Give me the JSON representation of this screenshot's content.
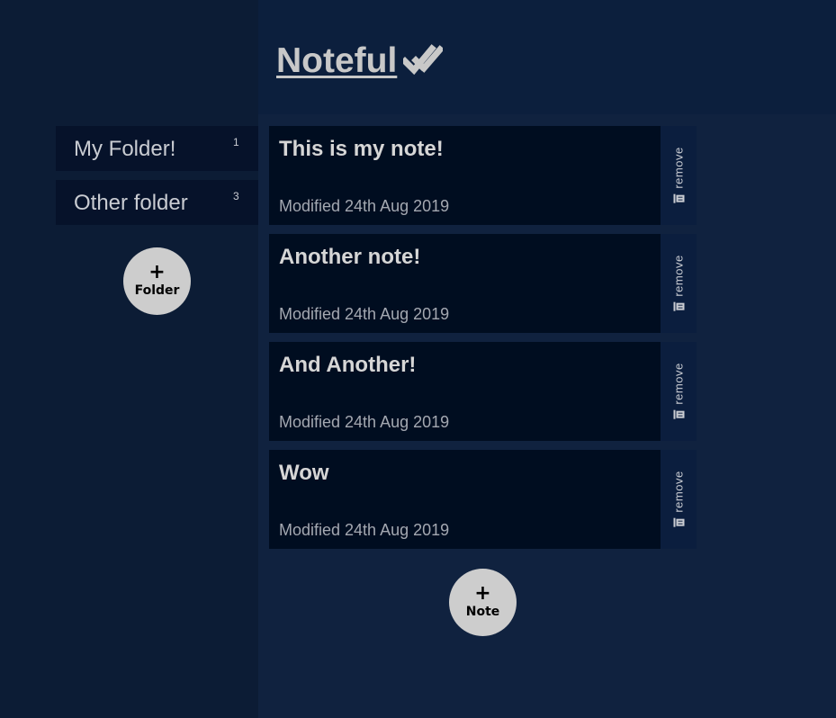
{
  "app": {
    "title": "Noteful",
    "title_icon": "double-check-icon"
  },
  "sidebar": {
    "folders": [
      {
        "name": "My Folder!",
        "count": "1"
      },
      {
        "name": "Other folder",
        "count": "3"
      }
    ],
    "add_button": {
      "plus": "+",
      "label": "Folder"
    }
  },
  "notes": [
    {
      "title": "This is my note!",
      "modified": "Modified 24th Aug 2019",
      "remove_label": "remove"
    },
    {
      "title": "Another note!",
      "modified": "Modified 24th Aug 2019",
      "remove_label": "remove"
    },
    {
      "title": "And Another!",
      "modified": "Modified 24th Aug 2019",
      "remove_label": "remove"
    },
    {
      "title": "Wow",
      "modified": "Modified 24th Aug 2019",
      "remove_label": "remove"
    }
  ],
  "add_note_button": {
    "plus": "+",
    "label": "Note"
  },
  "colors": {
    "page_background": "#10223f",
    "sidebar_background": "#0c1c35",
    "header_background": "#0c1f3d",
    "card_background": "#000d20",
    "button_background": "#cdcdcd",
    "text": "#c9ccd2"
  }
}
